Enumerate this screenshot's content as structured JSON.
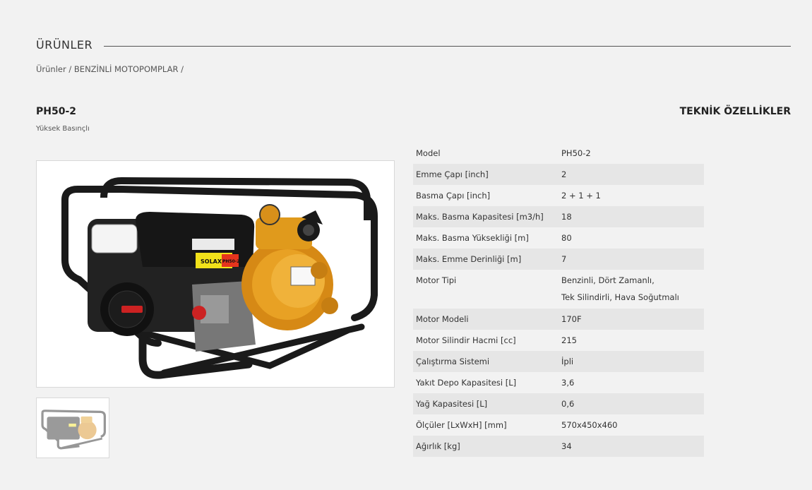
{
  "section": {
    "title": "ÜRÜNLER"
  },
  "breadcrumb": {
    "items": [
      "Ürünler",
      "BENZİNLİ MOTOPOMPLAR"
    ],
    "separator": " / "
  },
  "product": {
    "name": "PH50-2",
    "subtitle": "Yüksek Basınçlı",
    "brand_label": "SOLAX",
    "model_label": "PH50-2"
  },
  "specs": {
    "heading": "TEKNİK ÖZELLİKLER",
    "rows": [
      {
        "label": "Model",
        "value": "PH50-2"
      },
      {
        "label": "Emme Çapı [inch]",
        "value": "2"
      },
      {
        "label": "Basma Çapı [inch]",
        "value": "2 + 1 + 1"
      },
      {
        "label": "Maks. Basma Kapasitesi [m3/h]",
        "value": "18"
      },
      {
        "label": "Maks. Basma Yüksekliği [m]",
        "value": "80"
      },
      {
        "label": "Maks. Emme Derinliği [m]",
        "value": "7"
      },
      {
        "label": "Motor Tipi",
        "value": "Benzinli, Dört Zamanlı,",
        "value2": "Tek Silindirli, Hava Soğutmalı"
      },
      {
        "label": "Motor Modeli",
        "value": "170F"
      },
      {
        "label": "Motor Silindir Hacmi [cc]",
        "value": "215"
      },
      {
        "label": "Çalıştırma Sistemi",
        "value": "İpli"
      },
      {
        "label": "Yakıt Depo Kapasitesi [L]",
        "value": "3,6"
      },
      {
        "label": "Yağ Kapasitesi [L]",
        "value": "0,6"
      },
      {
        "label": "Ölçüler [LxWxH] [mm]",
        "value": "570x450x460"
      },
      {
        "label": "Ağırlık [kg]",
        "value": "34"
      }
    ]
  },
  "colors": {
    "background": "#f2f2f2",
    "row_alt": "#e6e6e6",
    "pump_orange": "#e09a1c",
    "frame_black": "#1a1a1a"
  }
}
